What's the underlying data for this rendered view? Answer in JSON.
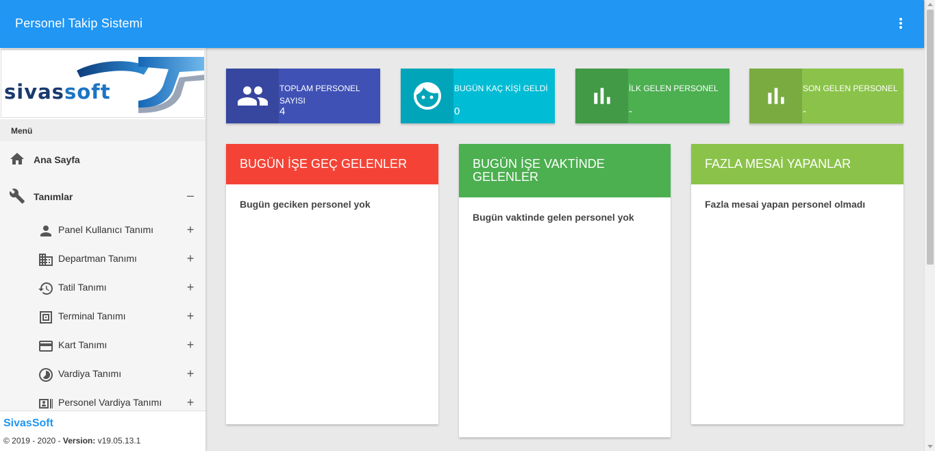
{
  "app": {
    "title": "Personel Takip Sistemi"
  },
  "colors": {
    "primary": "#2196f3",
    "indigo": "#3f51b5",
    "cyan": "#00bcd4",
    "green": "#4caf50",
    "light_green": "#8bc34a",
    "red": "#f44336"
  },
  "sidebar": {
    "logo": {
      "text_main": "sivas",
      "text_accent": "soft"
    },
    "menu_label": "Menü",
    "items": [
      {
        "label": "Ana Sayfa",
        "icon": "home-icon"
      },
      {
        "label": "Tanımlar",
        "icon": "wrench-icon",
        "sign": "–"
      }
    ],
    "sub_items": [
      {
        "label": "Panel Kullanıcı Tanımı",
        "icon": "person-icon",
        "sign": "+"
      },
      {
        "label": "Departman Tanımı",
        "icon": "building-icon",
        "sign": "+"
      },
      {
        "label": "Tatil Tanımı",
        "icon": "history-icon",
        "sign": "+"
      },
      {
        "label": "Terminal Tanımı",
        "icon": "terminal-icon",
        "sign": "+"
      },
      {
        "label": "Kart Tanımı",
        "icon": "card-icon",
        "sign": "+"
      },
      {
        "label": "Vardiya Tanımı",
        "icon": "shift-icon",
        "sign": "+"
      },
      {
        "label": "Personel Vardiya Tanımı",
        "icon": "badge-icon",
        "sign": "+"
      }
    ],
    "footer": {
      "brand": "SivasSoft",
      "copyright": "© 2019 - 2020 - ",
      "version_label": "Version:",
      "version": " v19.05.13.1"
    }
  },
  "info_boxes": [
    {
      "label": "TOPLAM PERSONEL SAYISI",
      "value": "4",
      "icon": "people-icon"
    },
    {
      "label": "BUGÜN KAÇ KİŞİ GELDİ",
      "value": "0",
      "icon": "face-icon"
    },
    {
      "label": "İLK GELEN PERSONEL",
      "value": "-",
      "icon": "bar-chart-icon"
    },
    {
      "label": "SON GELEN PERSONEL",
      "value": "-",
      "icon": "bar-chart-icon"
    }
  ],
  "cards": [
    {
      "title": "BUGÜN İŞE GEÇ GELENLER",
      "body": "Bugün geciken personel yok"
    },
    {
      "title": "BUGÜN İŞE VAKTİNDE GELENLER",
      "body": "Bugün vaktinde gelen personel yok"
    },
    {
      "title": "FAZLA MESAİ YAPANLAR",
      "body": "Fazla mesai yapan personel olmadı"
    }
  ]
}
